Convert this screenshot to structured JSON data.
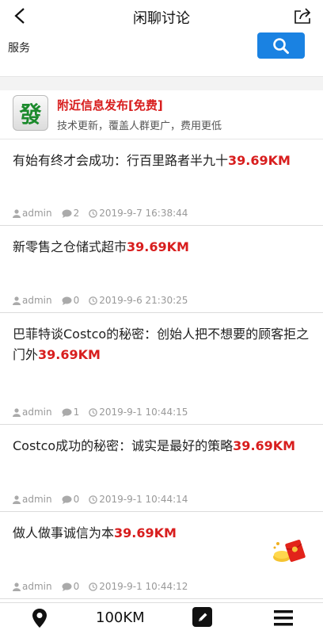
{
  "header": {
    "title": "闲聊讨论"
  },
  "search": {
    "value": "服务",
    "placeholder": ""
  },
  "promo": {
    "logo_char": "發",
    "title": "附近信息发布[免费]",
    "subtitle": "技术更新，覆盖人群更广，费用更低"
  },
  "posts": [
    {
      "title": "有始有终才会成功：行百里路者半九十",
      "distance": "39.69KM",
      "author": "admin",
      "comments": "2",
      "date": "2019-9-7 16:38:44"
    },
    {
      "title": "新零售之仓储式超市",
      "distance": "39.69KM",
      "author": "admin",
      "comments": "0",
      "date": "2019-9-6 21:30:25"
    },
    {
      "title": "巴菲特谈Costco的秘密：创始人把不想要的顾客拒之门外",
      "distance": "39.69KM",
      "author": "admin",
      "comments": "1",
      "date": "2019-9-1 10:44:15"
    },
    {
      "title": "Costco成功的秘密：诚实是最好的策略",
      "distance": "39.69KM",
      "author": "admin",
      "comments": "0",
      "date": "2019-9-1 10:44:14"
    },
    {
      "title": "做人做事诚信为本",
      "distance": "39.69KM",
      "author": "admin",
      "comments": "0",
      "date": "2019-9-1 10:44:12"
    }
  ],
  "tabbar": {
    "distance": "100KM"
  },
  "colors": {
    "accent": "#1a82e2",
    "highlight": "#d81e1e"
  },
  "icons": [
    "back-icon",
    "share-icon",
    "search-icon",
    "user-icon",
    "comment-icon",
    "clock-icon",
    "location-icon",
    "edit-icon",
    "menu-icon",
    "red-packet-icon"
  ]
}
